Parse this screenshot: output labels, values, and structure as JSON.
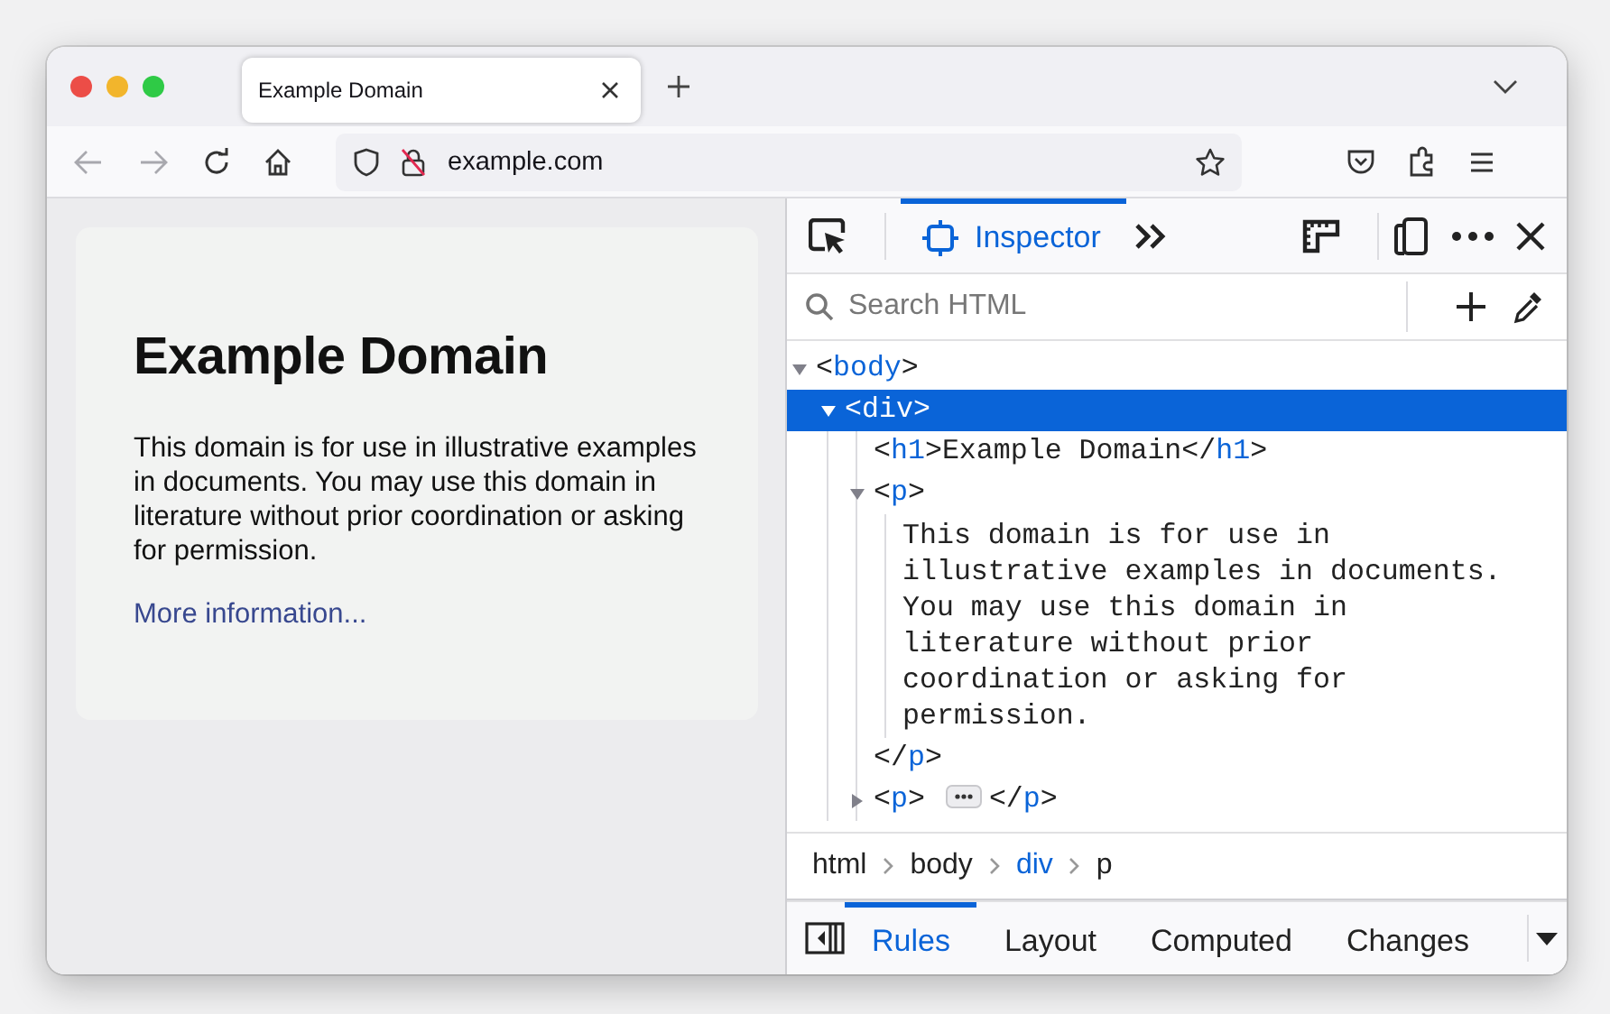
{
  "browser_tab": {
    "title": "Example Domain",
    "selected": true
  },
  "nav": {
    "back_disabled": true,
    "forward_disabled": true
  },
  "url": "example.com",
  "page": {
    "heading": "Example Domain",
    "paragraph": "This domain is for use in illustrative examples in documents. You may use this domain in literature without prior coordination or asking for permission.",
    "link": "More information..."
  },
  "devtools": {
    "tabs": [
      {
        "label": "Inspector",
        "selected": true
      }
    ],
    "search": {
      "placeholder": "Search HTML"
    },
    "markup_tree": [
      {
        "kind": "element",
        "expanded": true,
        "selected": false,
        "open": {
          "lt": "<",
          "name": "body",
          "gt": ">"
        },
        "children": [
          {
            "kind": "element",
            "expanded": true,
            "selected": true,
            "open": {
              "lt": "<",
              "name": "div",
              "gt": ">"
            },
            "children": [
              {
                "kind": "inline",
                "selected": false,
                "open": {
                  "lt": "<",
                  "name": "h1",
                  "gt": ">"
                },
                "text": "Example Domain",
                "close": {
                  "lt": "</",
                  "name": "h1",
                  "gt": ">"
                }
              },
              {
                "kind": "element",
                "expanded": true,
                "selected": false,
                "open": {
                  "lt": "<",
                  "name": "p",
                  "gt": ">"
                },
                "children": [
                  {
                    "kind": "text",
                    "text": "This domain is for use in illustrative examples in documents. You may use this domain in literature without prior coordination or asking for permission."
                  }
                ],
                "close": {
                  "lt": "</",
                  "name": "p",
                  "gt": ">"
                }
              },
              {
                "kind": "element",
                "expanded": false,
                "selected": false,
                "open": {
                  "lt": "<",
                  "name": "p",
                  "gt": ">"
                },
                "close": {
                  "lt": "</",
                  "name": "p",
                  "gt": ">"
                }
              }
            ]
          }
        ]
      }
    ],
    "breadcrumbs": [
      {
        "label": "html",
        "selected": false
      },
      {
        "label": "body",
        "selected": false
      },
      {
        "label": "div",
        "selected": true
      },
      {
        "label": "p",
        "selected": false
      }
    ],
    "sidebar_tabs": [
      {
        "label": "Rules",
        "selected": true
      },
      {
        "label": "Layout",
        "selected": false
      },
      {
        "label": "Computed",
        "selected": false
      },
      {
        "label": "Changes",
        "selected": false
      }
    ]
  }
}
